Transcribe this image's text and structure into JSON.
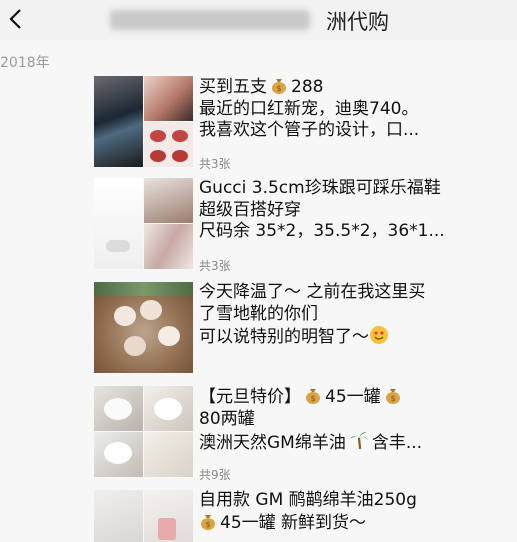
{
  "header": {
    "title_visible": "洲代购"
  },
  "year_label": "2018年",
  "icons": {
    "back": "chevron-left-icon",
    "money_bag": "money-bag-icon",
    "palm": "palm-tree-icon",
    "face": "heart-eyes-face-icon"
  },
  "posts": [
    {
      "lines": [
        "买到五支",
        "288",
        "最近的口红新宠，迪奥740。",
        "我喜欢这个管子的设计，口..."
      ],
      "count": "共3张"
    },
    {
      "lines": [
        "Gucci 3.5cm珍珠跟可踩乐福鞋",
        "超级百搭好穿",
        "尺码余 35*2，35.5*2，36*1..."
      ],
      "count": "共3张"
    },
    {
      "lines": [
        "今天降温了～ 之前在我这里买",
        "了雪地靴的你们",
        "可以说特别的明智了～"
      ]
    },
    {
      "lines": [
        "【元旦特价】",
        "45一罐",
        "80两罐",
        "澳洲天然GM绵羊油",
        "含丰..."
      ],
      "count": "共9张"
    },
    {
      "lines": [
        "自用款 GM 鸸鹋绵羊油250g",
        "45一罐 新鲜到货～"
      ]
    }
  ]
}
